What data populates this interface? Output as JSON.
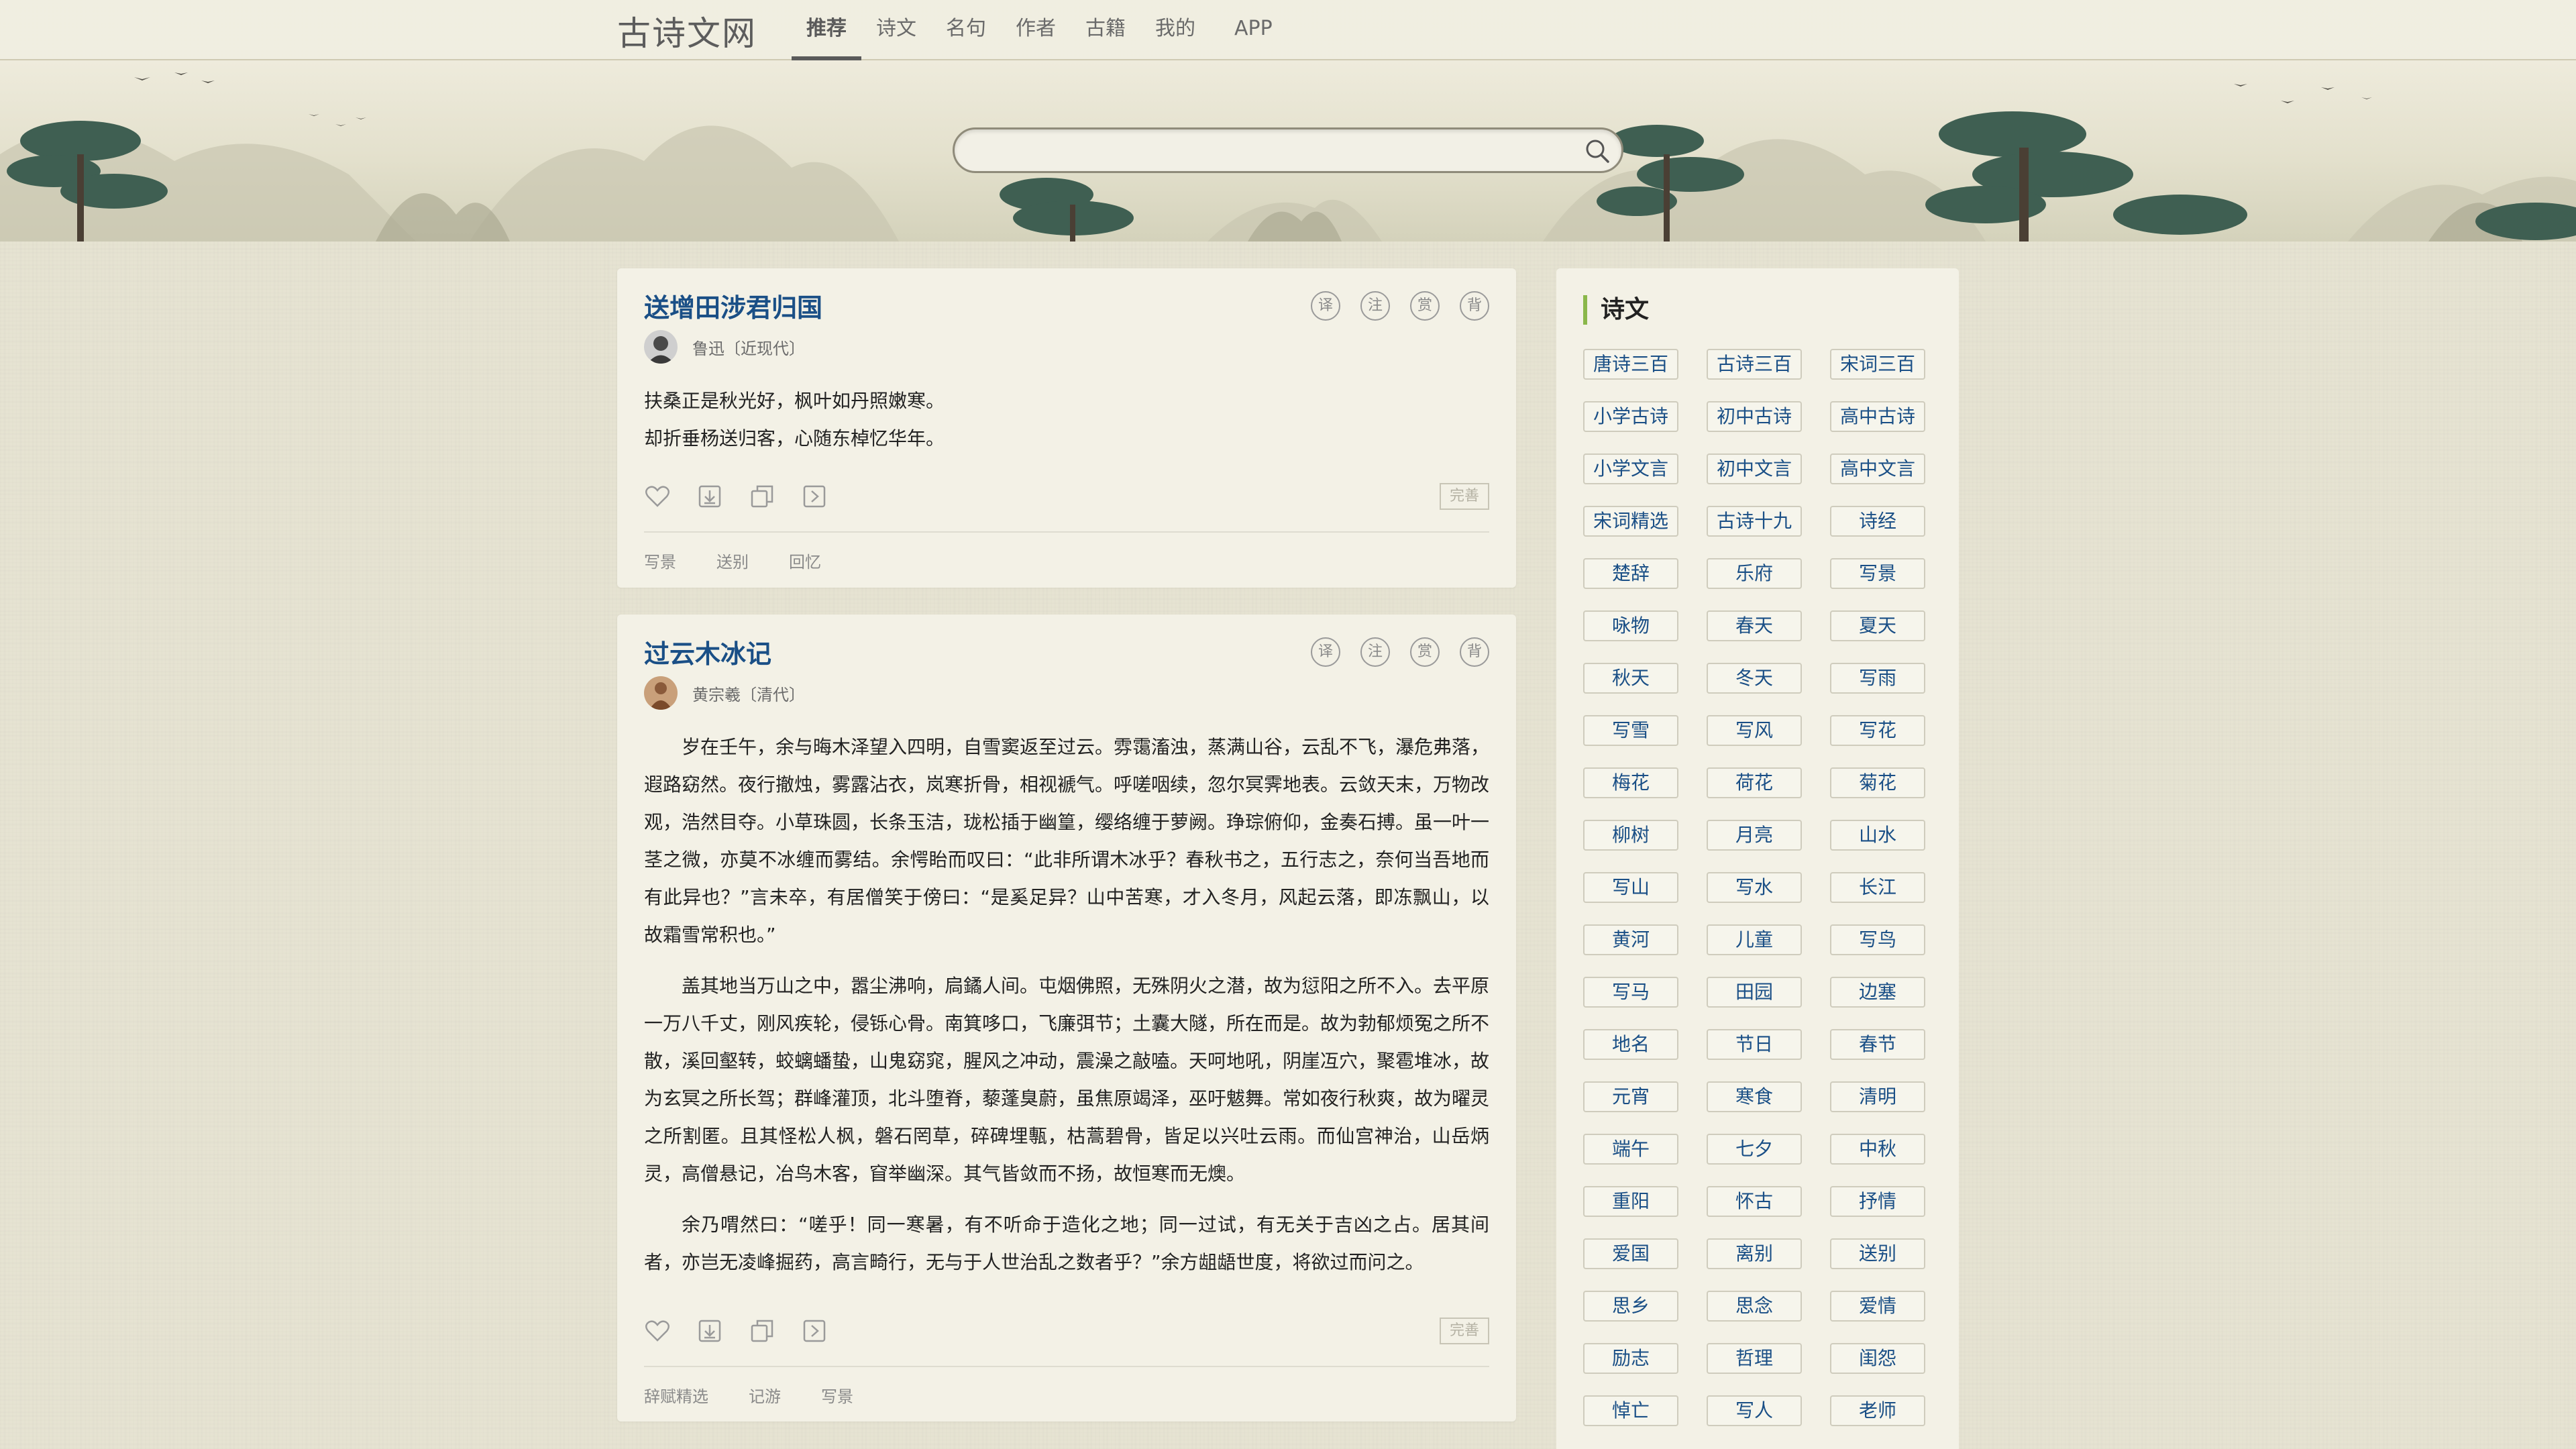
{
  "site": {
    "logo": "古诗文网"
  },
  "nav": [
    {
      "label": "推荐",
      "active": true
    },
    {
      "label": "诗文"
    },
    {
      "label": "名句"
    },
    {
      "label": "作者"
    },
    {
      "label": "古籍"
    },
    {
      "label": "我的"
    },
    {
      "label": "APP"
    }
  ],
  "search": {
    "value": "",
    "placeholder": ""
  },
  "card1": {
    "title": "送增田涉君归国",
    "author": "鲁迅〔近现代〕",
    "lines": [
      "扶桑正是秋光好，枫叶如丹照嫩寒。",
      "却折垂杨送归客，心随东棹忆华年。"
    ],
    "tools": [
      "译",
      "注",
      "赏",
      "背"
    ],
    "tags": [
      "写景",
      "送别",
      "回忆"
    ],
    "improve": "完善"
  },
  "card2": {
    "title": "过云木冰记",
    "author": "黄宗羲〔清代〕",
    "paragraphs": [
      "岁在壬午，余与晦木泽望入四明，自雪窦返至过云。雰霭滀浊，蒸满山谷，云乱不飞，瀑危弗落，遐路窈然。夜行撤烛，雾露沾衣，岚寒折骨，相视褫气。呼嗟咽续，忽尔冥霁地表。云敛天末，万物改观，浩然目夺。小草珠圆，长条玉洁，珑松插于幽篁，缨络缠于萝阙。琤琮俯仰，金奏石搏。虽一叶一茎之微，亦莫不冰缠而雾结。余愕眙而叹曰：“此非所谓木冰乎？春秋书之，五行志之，奈何当吾地而有此异也？”言未卒，有居僧笑于傍曰：“是奚足异？山中苦寒，才入冬月，风起云落，即冻飘山，以故霜雪常积也。”",
      "盖其地当万山之中，嚣尘沸响，扃鐍人间。屯烟佛照，无殊阴火之潜，故为愆阳之所不入。去平原一万八千丈，刚风疾轮，侵铄心骨。南箕哆口，飞廉弭节；土囊大隧，所在而是。故为勃郁烦冤之所不散，溪回壑转，蛟螭蟠蛰，山鬼窈窕，腥风之冲动，震澡之敲嗑。天呵地吼，阴崖冱穴，聚雹堆冰，故为玄冥之所长驾；群峰灌顶，北斗堕脊，藜蓬臭蔚，虽焦原竭泽，巫吁魃舞。常如夜行秋爽，故为曜灵之所割匿。且其怪松人枫，磐石罔草，碎碑埋甎，枯蒿碧骨，皆足以兴吐云雨。而仙宫神治，山岳炳灵，高僧悬记，冶鸟木客，窅举幽深。其气皆敛而不扬，故恒寒而无燠。",
      "余乃喟然曰：“嗟乎！同一寒暑，有不听命于造化之地；同一过试，有无关于吉凶之占。居其间者，亦岂无凌峰掘药，高言畸行，无与于人世治乱之数者乎？”余方龃龉世度，将欲过而问之。"
    ],
    "tools": [
      "译",
      "注",
      "赏",
      "背"
    ],
    "tags": [
      "辞赋精选",
      "记游",
      "写景"
    ],
    "improve": "完善"
  },
  "sidebar": {
    "title": "诗文",
    "items": [
      "唐诗三百",
      "古诗三百",
      "宋词三百",
      "小学古诗",
      "初中古诗",
      "高中古诗",
      "小学文言",
      "初中文言",
      "高中文言",
      "宋词精选",
      "古诗十九",
      "诗经",
      "楚辞",
      "乐府",
      "写景",
      "咏物",
      "春天",
      "夏天",
      "秋天",
      "冬天",
      "写雨",
      "写雪",
      "写风",
      "写花",
      "梅花",
      "荷花",
      "菊花",
      "柳树",
      "月亮",
      "山水",
      "写山",
      "写水",
      "长江",
      "黄河",
      "儿童",
      "写鸟",
      "写马",
      "田园",
      "边塞",
      "地名",
      "节日",
      "春节",
      "元宵",
      "寒食",
      "清明",
      "端午",
      "七夕",
      "中秋",
      "重阳",
      "怀古",
      "抒情",
      "爱国",
      "离别",
      "送别",
      "思乡",
      "思念",
      "爱情",
      "励志",
      "哲理",
      "闺怨",
      "悼亡",
      "写人",
      "老师"
    ]
  },
  "colors": {
    "link": "#1a4f86",
    "accent_bar": "#8ab74a",
    "page_bg": "#e6e3d2",
    "card_bg": "#f3f1e6"
  }
}
